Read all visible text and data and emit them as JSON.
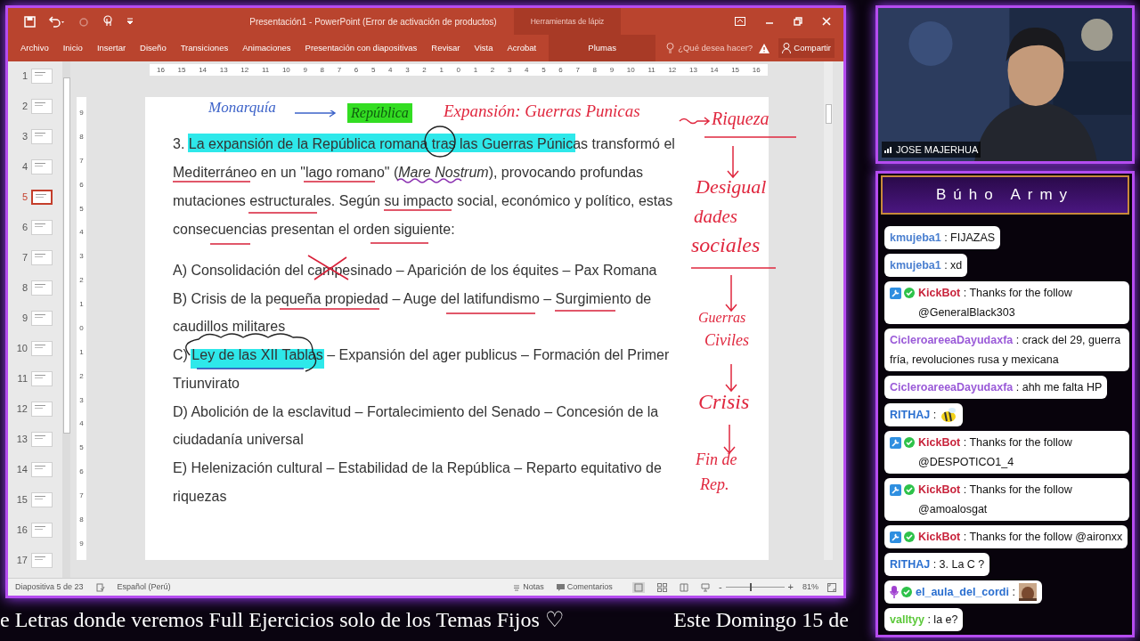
{
  "window": {
    "title": "Presentación1 - PowerPoint (Error de activación de productos)",
    "contextual_group": "Herramientas de lápiz"
  },
  "ribbon": {
    "tabs": [
      {
        "label": "Archivo",
        "kind": "normal"
      },
      {
        "label": "Inicio",
        "kind": "normal"
      },
      {
        "label": "Insertar",
        "kind": "normal"
      },
      {
        "label": "Diseño",
        "kind": "normal"
      },
      {
        "label": "Transiciones",
        "kind": "normal"
      },
      {
        "label": "Animaciones",
        "kind": "normal"
      },
      {
        "label": "Presentación con diapositivas",
        "kind": "normal"
      },
      {
        "label": "Revisar",
        "kind": "normal"
      },
      {
        "label": "Vista",
        "kind": "normal"
      },
      {
        "label": "Acrobat",
        "kind": "normal"
      },
      {
        "label": "Plumas",
        "kind": "contextual"
      }
    ],
    "search": {
      "placeholder": "¿Qué desea hacer?"
    },
    "share": "Compartir"
  },
  "rulers": {
    "horizontal": [
      "16",
      "15",
      "14",
      "13",
      "12",
      "11",
      "10",
      "9",
      "8",
      "7",
      "6",
      "5",
      "4",
      "3",
      "2",
      "1",
      "0",
      "1",
      "2",
      "3",
      "4",
      "5",
      "6",
      "7",
      "8",
      "9",
      "10",
      "11",
      "12",
      "13",
      "14",
      "15",
      "16"
    ],
    "vertical": [
      "9",
      "8",
      "7",
      "6",
      "5",
      "4",
      "3",
      "2",
      "1",
      "0",
      "1",
      "2",
      "3",
      "4",
      "5",
      "6",
      "7",
      "8",
      "9"
    ]
  },
  "thumbnails": [
    {
      "number": "1",
      "selected": false
    },
    {
      "number": "2",
      "selected": false
    },
    {
      "number": "3",
      "selected": false
    },
    {
      "number": "4",
      "selected": false
    },
    {
      "number": "5",
      "selected": true
    },
    {
      "number": "6",
      "selected": false
    },
    {
      "number": "7",
      "selected": false
    },
    {
      "number": "8",
      "selected": false
    },
    {
      "number": "9",
      "selected": false
    },
    {
      "number": "10",
      "selected": false
    },
    {
      "number": "11",
      "selected": false
    },
    {
      "number": "12",
      "selected": false
    },
    {
      "number": "13",
      "selected": false
    },
    {
      "number": "14",
      "selected": false
    },
    {
      "number": "15",
      "selected": false
    },
    {
      "number": "16",
      "selected": false
    },
    {
      "number": "17",
      "selected": false
    }
  ],
  "slide": {
    "question": "3. La expansión de la República romana tras las Guerras Púnicas transformó el Mediterráneo en un \"lago romano\" (*Mare Nostrum*), provocando profundas mutaciones estructurales. Según su impacto social, económico y político, estas consecuencias presentan el orden siguiente:",
    "options": [
      "A) Consolidación del campesinado – Aparición de los équites – Pax Romana",
      "B) Crisis de la pequeña propiedad – Auge del latifundismo – Surgimiento de caudillos militares",
      "C) Ley de las XII Tablas – Expansión del ager publicus – Formación del Primer Triunvirato",
      "D) Abolición de la esclavitud – Fortalecimiento del Senado – Concesión de la ciudadanía universal",
      "E) Helenización cultural – Estabilidad de la República – Reparto equitativo de riquezas"
    ],
    "annotations": [
      {
        "text": "Monarquía",
        "color": "#3d63c9"
      },
      {
        "text": "República",
        "color": "#33dd22",
        "kind": "highlighted"
      },
      {
        "text": "Expansión: Guerras Punicas",
        "color": "#e0283f"
      },
      {
        "text": "Riqueza",
        "color": "#e0283f"
      },
      {
        "text": "Desigual",
        "color": "#e0283f"
      },
      {
        "text": "dades",
        "color": "#e0283f"
      },
      {
        "text": "sociales",
        "color": "#e0283f"
      },
      {
        "text": "Guerras",
        "color": "#e0283f"
      },
      {
        "text": "Civiles",
        "color": "#e0283f"
      },
      {
        "text": "Crisis",
        "color": "#e0283f"
      },
      {
        "text": "Fin de",
        "color": "#e0283f"
      },
      {
        "text": "Rep.",
        "color": "#e0283f"
      }
    ]
  },
  "status_bar": {
    "slide_counter": "Diapositiva 5 de 23",
    "language": "Español (Perú)",
    "notes": "Notas",
    "comments": "Comentarios",
    "zoom": {
      "zoom_out": "-",
      "zoom_in": "+",
      "level": 0.42,
      "reading": "81%"
    }
  },
  "ticker": [
    "e Letras donde veremos Full Ejercicios solo de los Temas Fijos ♡",
    "Este Domingo 15 de"
  ],
  "webcam": {
    "name": "JOSE MAJERHUA"
  },
  "chat": {
    "title": "Búho Army",
    "messages": [
      {
        "user": "kmujeba1",
        "color": "#4a7fd0",
        "text": ": FIJAZAS",
        "bot": false,
        "verified": false,
        "mic": false
      },
      {
        "user": "kmujeba1",
        "color": "#4a7fd0",
        "text": ": xd",
        "bot": false,
        "verified": false,
        "mic": false
      },
      {
        "user": "KickBot",
        "color": "#c8243c",
        "text": ": Thanks for the follow @GeneralBlack303",
        "bot": true,
        "verified": true,
        "mic": false
      },
      {
        "user": "CicleroareeaDayudaxfa",
        "color": "#9a5ad8",
        "text": ": crack del 29, guerra fría, revoluciones rusa y mexicana",
        "bot": false,
        "verified": false,
        "mic": false
      },
      {
        "user": "CicleroareeaDayudaxfa",
        "color": "#9a5ad8",
        "text": ": ahh me falta HP",
        "bot": false,
        "verified": false,
        "mic": false
      },
      {
        "user": "RITHAJ",
        "color": "#2a6fd0",
        "text": ":",
        "bot": false,
        "verified": false,
        "mic": false,
        "emote": {
          "kind": "bee"
        }
      },
      {
        "user": "KickBot",
        "color": "#c8243c",
        "text": ": Thanks for the follow @DESPOTICO1_4",
        "bot": true,
        "verified": true,
        "mic": false
      },
      {
        "user": "KickBot",
        "color": "#c8243c",
        "text": ": Thanks for the follow @amoalosgat",
        "bot": true,
        "verified": true,
        "mic": false
      },
      {
        "user": "KickBot",
        "color": "#c8243c",
        "text": ": Thanks for the follow @aironxx",
        "bot": true,
        "verified": true,
        "mic": false
      },
      {
        "user": "RITHAJ",
        "color": "#2a6fd0",
        "text": ": 3. La C ?",
        "bot": false,
        "verified": false,
        "mic": false
      },
      {
        "user": "el_aula_del_cordi",
        "color": "#2a6fd0",
        "text": ":",
        "bot": false,
        "verified": true,
        "mic": true,
        "emote": {
          "kind": "face"
        }
      },
      {
        "user": "valltyy",
        "color": "#5cc83a",
        "text": ": la e?",
        "bot": false,
        "verified": false,
        "mic": false
      }
    ]
  }
}
